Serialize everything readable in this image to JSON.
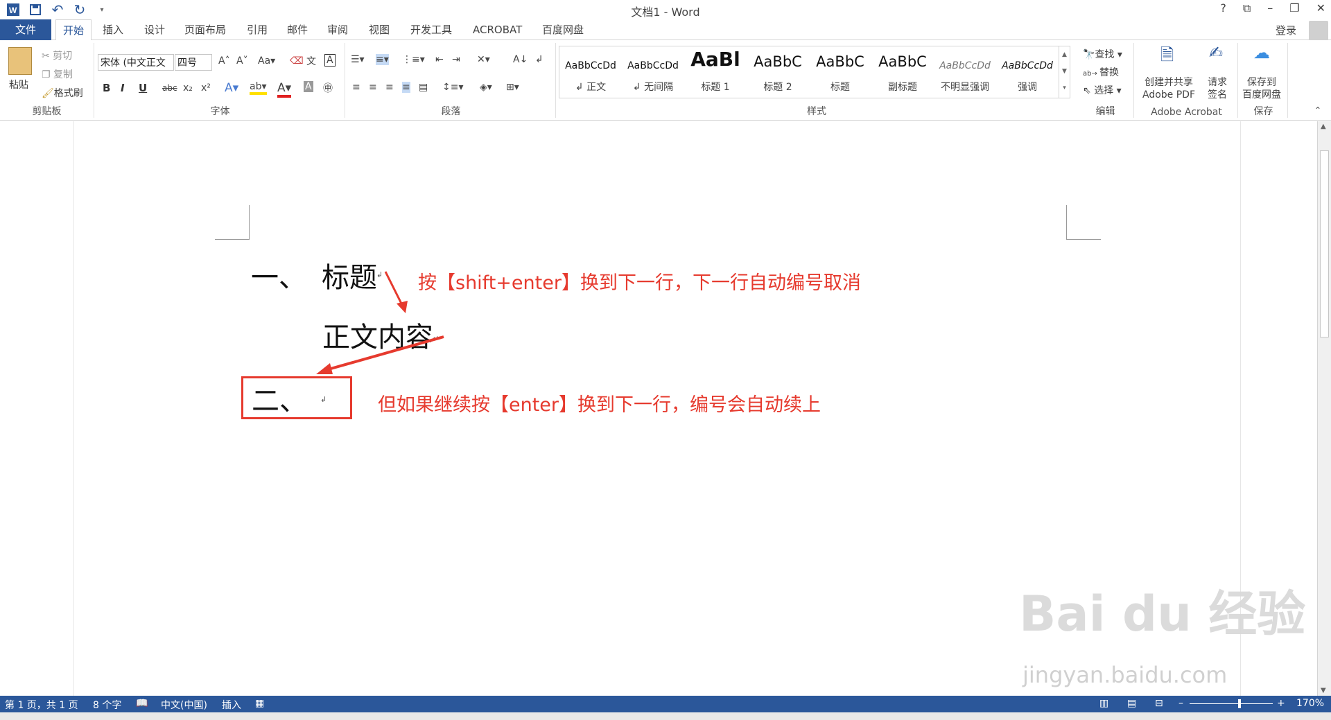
{
  "window": {
    "title": "文档1 - Word",
    "controls": [
      "?",
      "⧉",
      "–",
      "❐",
      "✕"
    ]
  },
  "qat": {
    "undo": "↶",
    "redo": "↻"
  },
  "tabs": [
    "文件",
    "开始",
    "插入",
    "设计",
    "页面布局",
    "引用",
    "邮件",
    "审阅",
    "视图",
    "开发工具",
    "ACROBAT",
    "百度网盘"
  ],
  "active_tab": "开始",
  "account": {
    "login": "登录"
  },
  "clipboard": {
    "paste": "粘贴",
    "cut": "剪切",
    "copy": "复制",
    "format_painter": "格式刷",
    "label": "剪贴板"
  },
  "font": {
    "name": "宋体 (中文正文",
    "size": "四号",
    "label": "字体",
    "bold": "B",
    "italic": "I",
    "underline": "U",
    "strike": "abc",
    "sub": "x₂",
    "sup": "x²"
  },
  "paragraph": {
    "label": "段落"
  },
  "styles": {
    "label": "样式",
    "items": [
      {
        "sample": "AaBbCcDd",
        "name": "↲ 正文"
      },
      {
        "sample": "AaBbCcDd",
        "name": "↲ 无间隔"
      },
      {
        "sample": "AaBl",
        "name": "标题 1"
      },
      {
        "sample": "AaBbC",
        "name": "标题 2"
      },
      {
        "sample": "AaBbC",
        "name": "标题"
      },
      {
        "sample": "AaBbC",
        "name": "副标题"
      },
      {
        "sample": "AaBbCcDd",
        "name": "不明显强调"
      },
      {
        "sample": "AaBbCcDd",
        "name": "强调"
      }
    ]
  },
  "editing": {
    "find": "查找",
    "replace": "替换",
    "select": "选择",
    "label": "编辑"
  },
  "acrobat": {
    "create": "创建并共享",
    "create2": "Adobe PDF",
    "sign": "请求",
    "sign2": "签名",
    "label": "Adobe Acrobat"
  },
  "baidu": {
    "save": "保存到",
    "save2": "百度网盘",
    "label": "保存"
  },
  "document": {
    "num1": "一、",
    "heading1": "标题",
    "body": "正文内容",
    "num2": "二、"
  },
  "annotations": {
    "note1": "按【shift+enter】换到下一行，下一行自动编号取消",
    "note2": "但如果继续按【enter】换到下一行，编号会自动续上",
    "accent": "#e63a2e"
  },
  "status": {
    "page": "第 1 页，共 1 页",
    "words": "8 个字",
    "lang": "中文(中国)",
    "mode": "插入",
    "zoom": "170%"
  },
  "watermark": {
    "brand": "Bai du 经验",
    "url": "jingyan.baidu.com"
  }
}
